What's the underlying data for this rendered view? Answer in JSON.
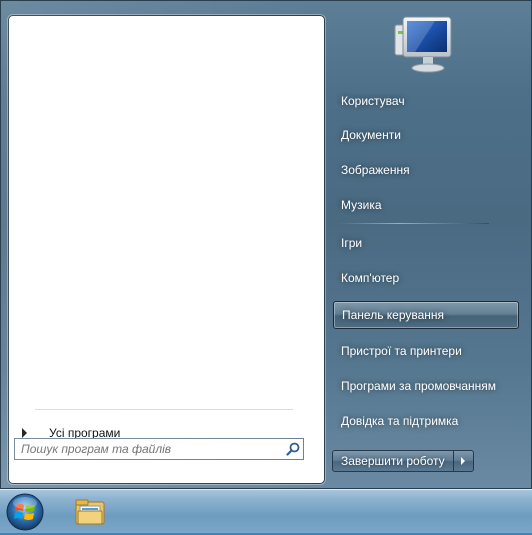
{
  "start_menu": {
    "all_programs_label": "Усі програми",
    "search": {
      "placeholder": "Пошук програм та файлів",
      "value": ""
    },
    "right_items": [
      {
        "label": "Користувач"
      },
      {
        "label": "Документи"
      },
      {
        "label": "Зображення"
      },
      {
        "label": "Музика"
      },
      {
        "label": "Ігри"
      },
      {
        "label": "Комп'ютер"
      },
      {
        "label": "Панель керування"
      },
      {
        "label": "Пристрої та принтери"
      },
      {
        "label": "Програми за промовчанням"
      },
      {
        "label": "Довідка та підтримка"
      }
    ],
    "highlighted_item": "Панель керування",
    "shutdown_label": "Завершити роботу"
  },
  "taskbar": {
    "start_icon": "windows-orb-icon",
    "pinned": [
      "windows-explorer-icon"
    ]
  },
  "colors": {
    "menu_bg": "#4d6f88",
    "taskbar": "#7aa6c8",
    "text_light": "#ffffff"
  }
}
